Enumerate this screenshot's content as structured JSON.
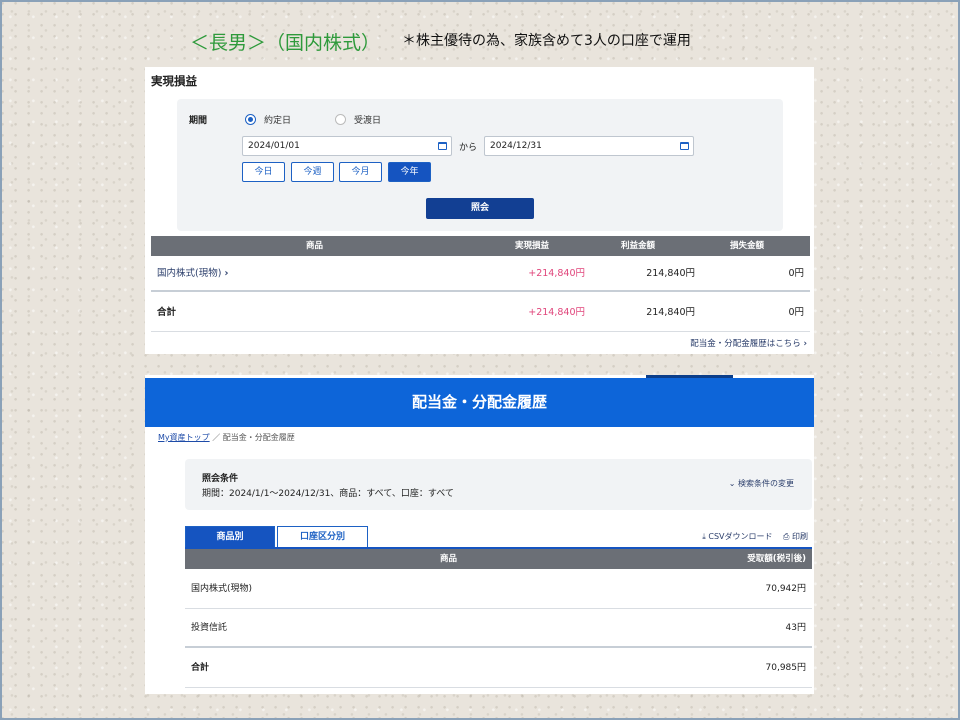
{
  "slide": {
    "title": "＜長男＞（国内株式）",
    "note": "＊株主優待の為、家族含めて3人の口座で運用"
  },
  "realized": {
    "title": "実現損益",
    "period_label": "期間",
    "radio_trade_date": "約定日",
    "radio_settlement_date": "受渡日",
    "selected_radio": "約定日",
    "date_from": "2024/01/01",
    "date_to": "2024/12/31",
    "kara": "から",
    "quick_buttons": [
      "今日",
      "今週",
      "今月",
      "今年"
    ],
    "active_quick": "今年",
    "search_button": "照会",
    "columns": [
      "商品",
      "実現損益",
      "利益金額",
      "損失金額"
    ],
    "row": {
      "product": "国内株式(現物)",
      "realized": "+214,840円",
      "profit": "214,840円",
      "loss": "0円"
    },
    "total": {
      "label": "合計",
      "realized": "+214,840円",
      "profit": "214,840円",
      "loss": "0円"
    },
    "dividend_link": "配当金・分配金履歴はこちら"
  },
  "dividend": {
    "banner": "配当金・分配金履歴",
    "breadcrumb_home": "My資産トップ",
    "breadcrumb_sep": "／",
    "breadcrumb_current": "配当金・分配金履歴",
    "condition_title": "照会条件",
    "condition_text": "期間：2024/1/1〜2024/12/31、商品：すべて、口座：すべて",
    "change_condition": "⌄ 検索条件の変更",
    "tab_product": "商品別",
    "tab_account": "口座区分別",
    "csv_download": "⤓ CSVダウンロード",
    "print": "⎙ 印刷",
    "columns": [
      "商品",
      "受取額(税引後)"
    ],
    "rows": [
      {
        "product": "国内株式(現物)",
        "amount": "70,942円"
      },
      {
        "product": "投資信託",
        "amount": "43円"
      }
    ],
    "total": {
      "label": "合計",
      "amount": "70,985円"
    }
  },
  "colors": {
    "accent_blue": "#0d65d9",
    "dark_button": "#123f93",
    "positive_pink": "#e0457b",
    "title_green": "#2e9a3b"
  }
}
